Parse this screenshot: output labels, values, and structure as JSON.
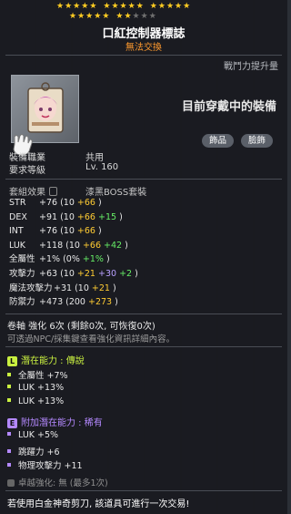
{
  "tooltip": {
    "star_force": {
      "filled": 22,
      "total": 25
    },
    "item_name": "口紅控制器標誌",
    "trade_status": "無法交換",
    "power_up_label": "戰鬥力提升量",
    "equipped_label": "目前穿戴中的裝備",
    "tags": [
      "飾品",
      "臉飾"
    ],
    "requirements": [
      {
        "label": "裝備職業",
        "value": "共用"
      },
      {
        "label": "要求等級",
        "value": "Lv. 160"
      }
    ],
    "set_effect": {
      "label": "套組效果",
      "name": "漆黑BOSS套裝"
    },
    "stats": [
      {
        "key": "STR",
        "total": "+76",
        "open": "(10",
        "parts": [
          {
            "t": "+66",
            "c": "y"
          }
        ],
        "close": ")"
      },
      {
        "key": "DEX",
        "total": "+91",
        "open": "(10",
        "parts": [
          {
            "t": "+66",
            "c": "y"
          },
          {
            "t": "+15",
            "c": "gr"
          }
        ],
        "close": ")"
      },
      {
        "key": "INT",
        "total": "+76",
        "open": "(10",
        "parts": [
          {
            "t": "+66",
            "c": "y"
          }
        ],
        "close": ")"
      },
      {
        "key": "LUK",
        "total": "+118",
        "open": "(10",
        "parts": [
          {
            "t": "+66",
            "c": "y"
          },
          {
            "t": "+42",
            "c": "gr"
          }
        ],
        "close": ")"
      },
      {
        "key": "全屬性",
        "total": "+1%",
        "open": "(0%",
        "parts": [
          {
            "t": "+1%",
            "c": "gr"
          }
        ],
        "close": ")"
      },
      {
        "key": "攻擊力",
        "total": "+63",
        "open": "(10",
        "parts": [
          {
            "t": "+21",
            "c": "y"
          },
          {
            "t": "+30",
            "c": "bl"
          },
          {
            "t": "+2",
            "c": "gr"
          }
        ],
        "close": ")"
      },
      {
        "key": "魔法攻擊力",
        "total": "+31",
        "open": "(10",
        "parts": [
          {
            "t": "+21",
            "c": "y"
          }
        ],
        "close": ")"
      },
      {
        "key": "防禦力",
        "total": "+473",
        "open": "(200",
        "parts": [
          {
            "t": "+273",
            "c": "y"
          }
        ],
        "close": ")"
      }
    ],
    "scroll_enhance": "卷軸 強化 6次 (剩餘0次, 可恢復0次)",
    "npc_note": "可透過NPC/採集鍵查看強化資訊詳細內容。",
    "potential": {
      "header": "潛在能力 : 傳說",
      "badge": "L",
      "color": "#c9f040",
      "lines": [
        "全屬性 +7%",
        "LUK +13%",
        "LUK +13%"
      ]
    },
    "additional": {
      "header": "附加潛在能力 : 稀有",
      "badge": "E",
      "color": "#b489ff",
      "lines": [
        "LUK +5%",
        "跳躍力 +6",
        "物理攻擊力 +11"
      ]
    },
    "star_force_enh": "卓越強化:  無 (最多1次)",
    "scissors_note": "若使用白金神奇剪刀, 該道具可進行一次交易!"
  }
}
